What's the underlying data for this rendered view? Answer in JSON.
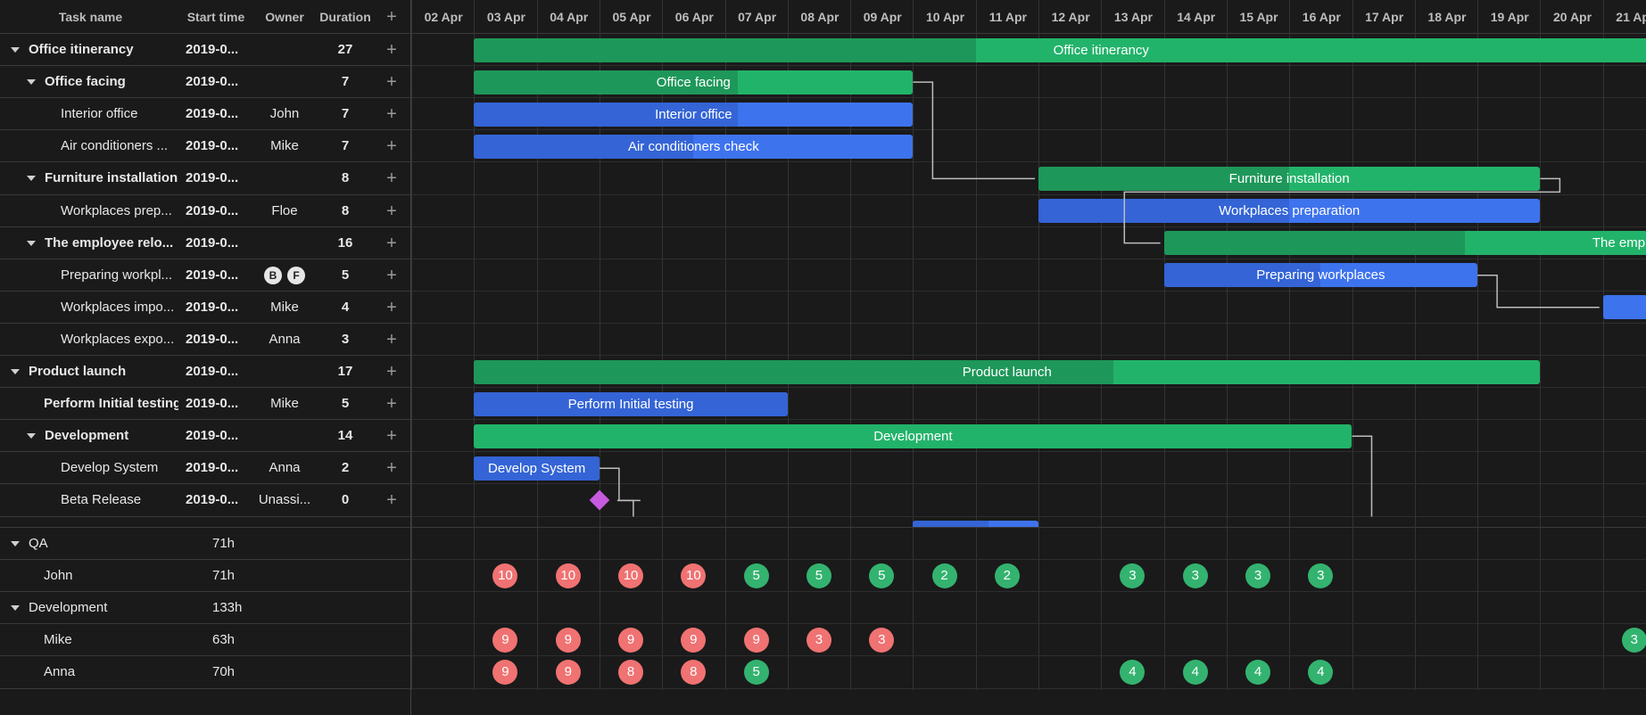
{
  "grid_headers": {
    "task_name": "Task name",
    "start_time": "Start time",
    "owner": "Owner",
    "duration": "Duration",
    "add": "+"
  },
  "dates": [
    "02 Apr",
    "03 Apr",
    "04 Apr",
    "05 Apr",
    "06 Apr",
    "07 Apr",
    "08 Apr",
    "09 Apr",
    "10 Apr",
    "11 Apr",
    "12 Apr",
    "13 Apr",
    "14 Apr",
    "15 Apr",
    "16 Apr",
    "17 Apr",
    "18 Apr",
    "19 Apr",
    "20 Apr",
    "21 Apr"
  ],
  "tasks": [
    {
      "name": "Office itinerancy",
      "start": "2019-0...",
      "owner": "",
      "duration": "27",
      "level": 0,
      "parent": true,
      "bold": true
    },
    {
      "name": "Office facing",
      "start": "2019-0...",
      "owner": "",
      "duration": "7",
      "level": 1,
      "parent": true,
      "bold": true
    },
    {
      "name": "Interior office",
      "start": "2019-0...",
      "owner": "John",
      "duration": "7",
      "level": 2,
      "parent": false,
      "bold": false
    },
    {
      "name": "Air conditioners ...",
      "start": "2019-0...",
      "owner": "Mike",
      "duration": "7",
      "level": 2,
      "parent": false,
      "bold": false
    },
    {
      "name": "Furniture installation",
      "start": "2019-0...",
      "owner": "",
      "duration": "8",
      "level": 1,
      "parent": true,
      "bold": true
    },
    {
      "name": "Workplaces prep...",
      "start": "2019-0...",
      "owner": "Floe",
      "duration": "8",
      "level": 2,
      "parent": false,
      "bold": false
    },
    {
      "name": "The employee relo...",
      "start": "2019-0...",
      "owner": "",
      "duration": "16",
      "level": 1,
      "parent": true,
      "bold": true
    },
    {
      "name": "Preparing workpl...",
      "start": "2019-0...",
      "owner": "",
      "avatars": [
        "B",
        "F"
      ],
      "duration": "5",
      "level": 2,
      "parent": false,
      "bold": false
    },
    {
      "name": "Workplaces impo...",
      "start": "2019-0...",
      "owner": "Mike",
      "duration": "4",
      "level": 2,
      "parent": false,
      "bold": false
    },
    {
      "name": "Workplaces expo...",
      "start": "2019-0...",
      "owner": "Anna",
      "duration": "3",
      "level": 2,
      "parent": false,
      "bold": false
    },
    {
      "name": "Product launch",
      "start": "2019-0...",
      "owner": "",
      "duration": "17",
      "level": 0,
      "parent": true,
      "bold": true
    },
    {
      "name": "Perform Initial testing",
      "start": "2019-0...",
      "owner": "Mike",
      "duration": "5",
      "level": 1,
      "parent": false,
      "bold": true
    },
    {
      "name": "Development",
      "start": "2019-0...",
      "owner": "",
      "duration": "14",
      "level": 1,
      "parent": true,
      "bold": true
    },
    {
      "name": "Develop System",
      "start": "2019-0...",
      "owner": "Anna",
      "duration": "2",
      "level": 2,
      "parent": false,
      "bold": false
    },
    {
      "name": "Beta Release",
      "start": "2019-0...",
      "owner": "Unassi...",
      "duration": "0",
      "level": 2,
      "parent": false,
      "bold": false
    }
  ],
  "bars": [
    {
      "row": 0,
      "label": "Office itinerancy",
      "color": "green",
      "startDay": 1,
      "days": 20,
      "progress": 0.4
    },
    {
      "row": 1,
      "label": "Office facing",
      "color": "green",
      "startDay": 1,
      "days": 7,
      "progress": 0.6
    },
    {
      "row": 2,
      "label": "Interior office",
      "color": "blue",
      "startDay": 1,
      "days": 7,
      "progress": 0.6
    },
    {
      "row": 3,
      "label": "Air conditioners check",
      "color": "blue",
      "startDay": 1,
      "days": 7,
      "progress": 0.5
    },
    {
      "row": 4,
      "label": "Furniture installation",
      "color": "green",
      "startDay": 10,
      "days": 8,
      "progress": 0.5
    },
    {
      "row": 5,
      "label": "Workplaces preparation",
      "color": "blue",
      "startDay": 10,
      "days": 8,
      "progress": 0.5
    },
    {
      "row": 6,
      "label": "The employee relocation",
      "color": "green",
      "startDay": 12,
      "days": 16,
      "progress": 0.3
    },
    {
      "row": 7,
      "label": "Preparing workplaces",
      "color": "blue",
      "startDay": 12,
      "days": 5,
      "progress": 0.5
    },
    {
      "row": 8,
      "label": "",
      "color": "blue",
      "startDay": 19,
      "days": 4,
      "progress": 0
    },
    {
      "row": 10,
      "label": "Product launch",
      "color": "green",
      "startDay": 1,
      "days": 17,
      "progress": 0.6
    },
    {
      "row": 11,
      "label": "Perform Initial testing",
      "color": "blue",
      "startDay": 1,
      "days": 5,
      "progress": 1
    },
    {
      "row": 12,
      "label": "Development",
      "color": "green",
      "startDay": 1,
      "days": 14,
      "progress": 0
    },
    {
      "row": 13,
      "label": "Develop System",
      "color": "blue",
      "startDay": 1,
      "days": 2,
      "progress": 1
    },
    {
      "row": 15,
      "label": "",
      "color": "blue",
      "startDay": 8,
      "days": 2,
      "progress": 0.6
    }
  ],
  "milestone": {
    "row": 14,
    "day": 3
  },
  "resources": [
    {
      "name": "QA",
      "hours": "71h",
      "group": true,
      "loads": []
    },
    {
      "name": "John",
      "hours": "71h",
      "group": false,
      "loads": [
        [
          1,
          "10",
          "red"
        ],
        [
          2,
          "10",
          "red"
        ],
        [
          3,
          "10",
          "red"
        ],
        [
          4,
          "10",
          "red"
        ],
        [
          5,
          "5",
          "gr"
        ],
        [
          6,
          "5",
          "gr"
        ],
        [
          7,
          "5",
          "gr"
        ],
        [
          8,
          "2",
          "gr"
        ],
        [
          9,
          "2",
          "gr"
        ],
        [
          11,
          "3",
          "gr"
        ],
        [
          12,
          "3",
          "gr"
        ],
        [
          13,
          "3",
          "gr"
        ],
        [
          14,
          "3",
          "gr"
        ]
      ]
    },
    {
      "name": "Development",
      "hours": "133h",
      "group": true,
      "loads": []
    },
    {
      "name": "Mike",
      "hours": "63h",
      "group": false,
      "loads": [
        [
          1,
          "9",
          "red"
        ],
        [
          2,
          "9",
          "red"
        ],
        [
          3,
          "9",
          "red"
        ],
        [
          4,
          "9",
          "red"
        ],
        [
          5,
          "9",
          "red"
        ],
        [
          6,
          "3",
          "red"
        ],
        [
          7,
          "3",
          "red"
        ],
        [
          19,
          "3",
          "gr"
        ]
      ]
    },
    {
      "name": "Anna",
      "hours": "70h",
      "group": false,
      "loads": [
        [
          1,
          "9",
          "red"
        ],
        [
          2,
          "9",
          "red"
        ],
        [
          3,
          "8",
          "red"
        ],
        [
          4,
          "8",
          "red"
        ],
        [
          5,
          "5",
          "gr"
        ],
        [
          11,
          "4",
          "gr"
        ],
        [
          12,
          "4",
          "gr"
        ],
        [
          13,
          "4",
          "gr"
        ],
        [
          14,
          "4",
          "gr"
        ]
      ]
    }
  ]
}
